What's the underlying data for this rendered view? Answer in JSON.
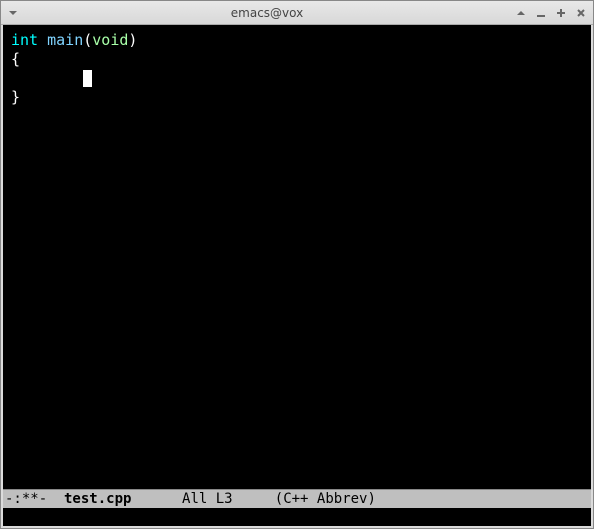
{
  "window": {
    "title": "emacs@vox"
  },
  "code": {
    "type_kw": "int",
    "fn_name": "main",
    "paren_open": "(",
    "void_kw": "void",
    "paren_close": ")",
    "brace_open": "{",
    "indent": "        ",
    "brace_close": "}"
  },
  "modeline": {
    "status": "-:**- ",
    "filename": " test.cpp",
    "gap1": "      ",
    "position": "All",
    "gap2": " ",
    "line": "L3",
    "gap3": "     ",
    "modes": "(C++ Abbrev)"
  }
}
